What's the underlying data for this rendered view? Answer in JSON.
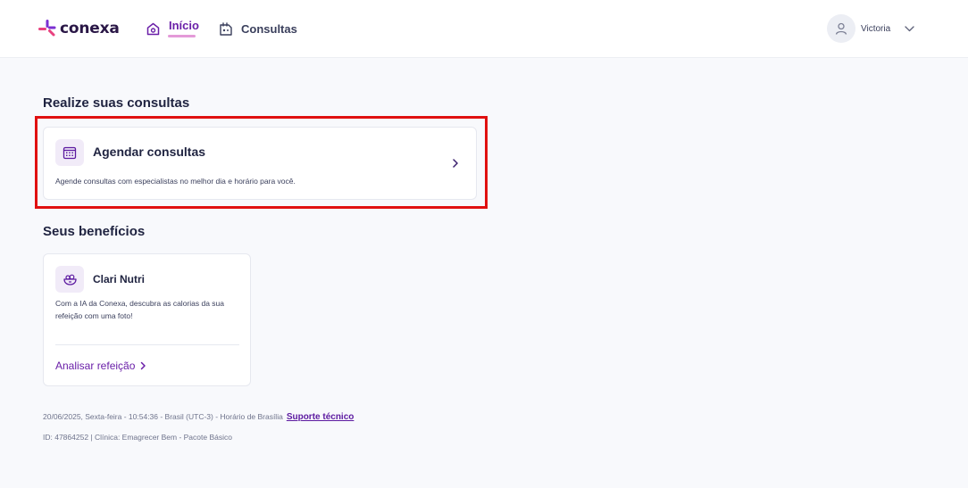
{
  "brand": {
    "name": "conexa",
    "accent": "#6a1fa8",
    "logo_pink": "#e8417f",
    "logo_purple": "#7b2fd1"
  },
  "nav": {
    "items": [
      {
        "label": "Início",
        "icon": "home-icon",
        "active": true
      },
      {
        "label": "Consultas",
        "icon": "consultations-icon",
        "active": false
      }
    ]
  },
  "user": {
    "name": "Victoria",
    "icon": "user-icon"
  },
  "sections": {
    "consultas_title": "Realize suas consultas",
    "beneficios_title": "Seus benefícios"
  },
  "cards": {
    "agendar": {
      "title": "Agendar consultas",
      "description": "Agende consultas com especialistas no melhor dia e horário para você.",
      "icon": "calendar-icon"
    },
    "clari": {
      "title": "Clari Nutri",
      "description": "Com a IA da Conexa, descubra as calorias da sua refeição com uma foto!",
      "action": "Analisar refeição",
      "icon": "food-bowl-icon"
    }
  },
  "footer": {
    "timestamp": "20/06/2025, Sexta-feira - 10:54:36 - Brasil (UTC-3) - Horário de Brasília",
    "support": "Suporte técnico",
    "info": "ID: 47864252 | Clínica: Emagrecer Bem - Pacote Básico"
  },
  "highlight_color": "#e01010"
}
